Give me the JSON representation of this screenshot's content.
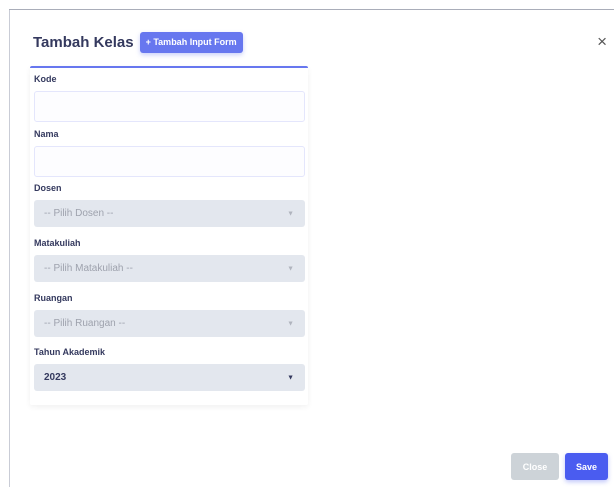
{
  "modal": {
    "title": "Tambah Kelas",
    "add_input_button": "+ Tambah Input Form",
    "close_icon": "×"
  },
  "form": {
    "kode_label": "Kode",
    "kode_value": "",
    "nama_label": "Nama",
    "nama_value": "",
    "dosen_label": "Dosen",
    "dosen_selected": "-- Pilih Dosen --",
    "matakuliah_label": "Matakuliah",
    "matakuliah_selected": "-- Pilih Matakuliah --",
    "ruangan_label": "Ruangan",
    "ruangan_selected": "-- Pilih Ruangan --",
    "tahun_label": "Tahun Akademik",
    "tahun_selected": "2023"
  },
  "footer": {
    "close_label": "Close",
    "save_label": "Save"
  },
  "colors": {
    "primary": "#6777ef",
    "save": "#4a5cf0",
    "close_disabled": "#cdd3d8",
    "select_bg": "#e3e7ee"
  },
  "icons": {
    "dropdown": "caret-down-icon",
    "close": "close-icon"
  }
}
